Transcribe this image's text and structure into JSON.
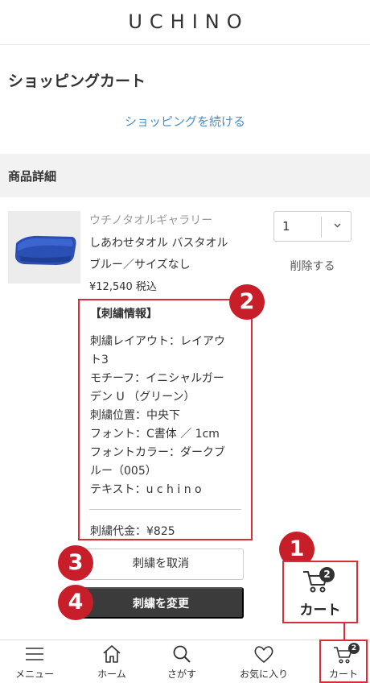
{
  "header": {
    "logo": "UCHINO"
  },
  "page": {
    "title": "ショッピングカート",
    "continue_shopping": "ショッピングを続ける",
    "section_title": "商品詳細"
  },
  "item": {
    "brand": "ウチノタオルギャラリー",
    "name_line1": "しあわせタオル バスタオル",
    "name_line2": "ブルー／サイズなし",
    "price": "¥12,540 税込",
    "quantity": "1",
    "delete_label": "削除する",
    "image_alt": "blue bath towel"
  },
  "embroidery": {
    "heading": "【刺繍情報】",
    "lines": [
      "刺繍レイアウト：レイアウ",
      "ト3",
      "モチーフ：イニシャルガー",
      "デン U （グリーン）",
      "刺繍位置：中央下",
      "フォント：C書体 ／ 1cm",
      "フォントカラー：ダークブ",
      "ルー（005）",
      "テキスト：u c h i n o"
    ],
    "fee": "刺繍代金：¥825",
    "cancel_label": "刺繍を取消",
    "change_label": "刺繍を変更"
  },
  "annotations": {
    "badge1": "1",
    "badge2": "2",
    "badge3": "3",
    "badge4": "4",
    "color": "#c81e2a"
  },
  "cart_callout": {
    "count": "2",
    "label": "カート"
  },
  "bottom_nav": {
    "items": [
      {
        "label": "メニュー",
        "icon": "menu-icon"
      },
      {
        "label": "ホーム",
        "icon": "home-icon"
      },
      {
        "label": "さがす",
        "icon": "search-icon"
      },
      {
        "label": "お気に入り",
        "icon": "heart-icon"
      },
      {
        "label": "カート",
        "icon": "cart-icon"
      }
    ],
    "cart_count": "2"
  },
  "colors": {
    "link": "#4d8fc9",
    "highlight_red": "#d92d3a",
    "dark_button": "#3b3b3b"
  }
}
